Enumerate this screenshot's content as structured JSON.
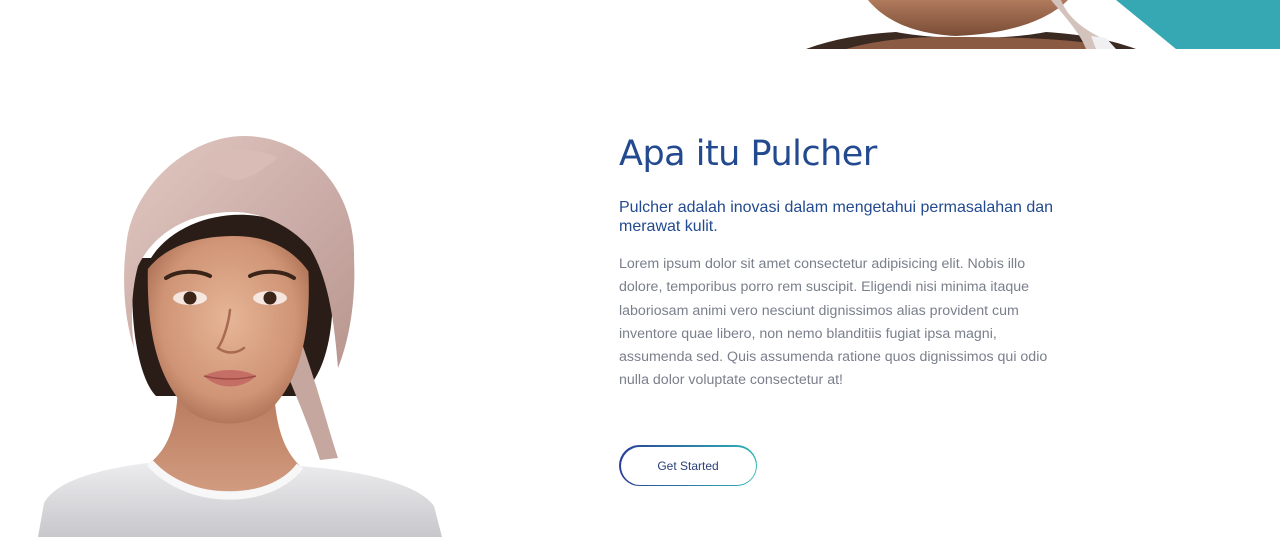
{
  "hero_strip": {
    "accent_color": "#36a8b4"
  },
  "about": {
    "title": "Apa itu Pulcher",
    "subtitle": "Pulcher adalah inovasi dalam mengetahui permasalahan dan merawat kulit.",
    "body": "Lorem ipsum dolor sit amet consectetur adipisicing elit. Nobis illo dolore, temporibus porro rem suscipit. Eligendi nisi minima itaque laboriosam animi vero nesciunt dignissimos alias provident cum inventore quae libero, non nemo blanditiis fugiat ipsa magni, assumenda sed. Quis assumenda ratione quos dignissimos qui odio nulla dolor voluptate consectetur at!",
    "cta_label": "Get Started"
  },
  "colors": {
    "heading": "#234a8f",
    "body": "#7a7f8c",
    "gradient_start": "#2a3f9a",
    "gradient_end": "#2fb5b2"
  }
}
